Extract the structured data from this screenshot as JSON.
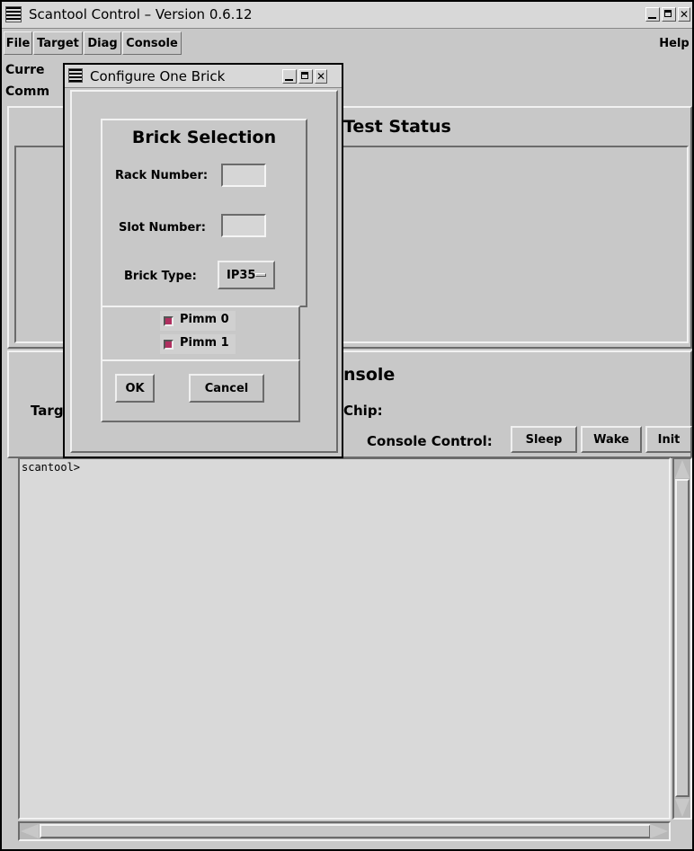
{
  "main_window": {
    "title": "Scantool Control –  Version 0.6.12",
    "menu": [
      "File",
      "Target",
      "Diag",
      "Console"
    ],
    "help_label": "Help",
    "current_label_partial": "Curre",
    "command_label_partial": "Comm",
    "test_status_title": "Test Status",
    "console_title_partial": "nsole",
    "target_label_partial": "Targ",
    "chip_label": "Chip:",
    "console_control_label": "Console Control:",
    "console_buttons": [
      "Sleep",
      "Wake",
      "Init"
    ],
    "console_prompt": "scantool>"
  },
  "dialog": {
    "title": "Configure One Brick",
    "section_title": "Brick Selection",
    "rack_label": "Rack Number:",
    "rack_value": "",
    "slot_label": "Slot Number:",
    "slot_value": "",
    "brick_type_label": "Brick Type:",
    "brick_type_value": "IP35",
    "pimms": [
      {
        "label": "Pimm 0",
        "checked": true
      },
      {
        "label": "Pimm 1",
        "checked": true
      }
    ],
    "ok_label": "OK",
    "cancel_label": "Cancel"
  },
  "colors": {
    "checkbox_on": "#b03060",
    "bg": "#c8c8c8"
  }
}
